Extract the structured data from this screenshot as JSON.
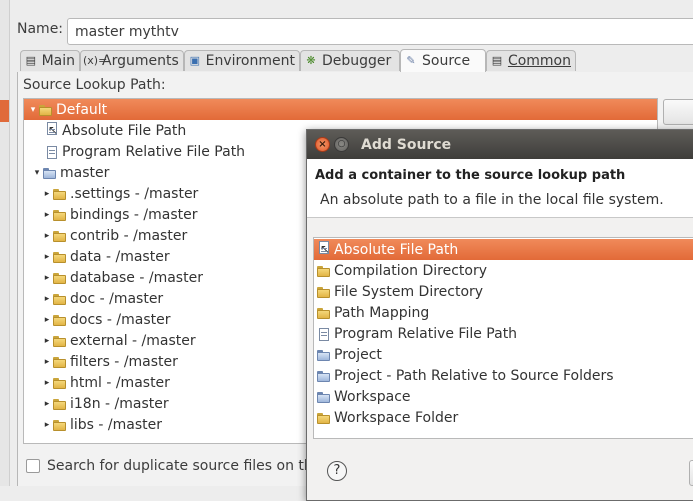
{
  "window": {
    "name_label": "Name:",
    "name_value": "master mythtv"
  },
  "tabs": [
    {
      "label": "Main",
      "icon": "main-tab-icon"
    },
    {
      "label": "Arguments",
      "icon": "arguments-icon"
    },
    {
      "label": "Environment",
      "icon": "environment-icon"
    },
    {
      "label": "Debugger",
      "icon": "debugger-bug-icon"
    },
    {
      "label": "Source",
      "icon": "source-icon",
      "active": true
    },
    {
      "label": "Common",
      "icon": "common-icon"
    }
  ],
  "source": {
    "lookup_label": "Source Lookup Path:",
    "tree": [
      {
        "label": "Default",
        "icon": "folder-icon",
        "expanded": true,
        "selected": true
      },
      {
        "label": "Absolute File Path",
        "icon": "absolute-path-icon"
      },
      {
        "label": "Program Relative File Path",
        "icon": "program-relative-icon"
      },
      {
        "label": "master",
        "icon": "project-folder-icon",
        "expanded": true
      },
      {
        "label": ".settings - /master",
        "icon": "folder-icon"
      },
      {
        "label": "bindings - /master",
        "icon": "folder-icon"
      },
      {
        "label": "contrib - /master",
        "icon": "folder-icon"
      },
      {
        "label": "data - /master",
        "icon": "folder-icon"
      },
      {
        "label": "database - /master",
        "icon": "folder-icon"
      },
      {
        "label": "doc - /master",
        "icon": "folder-icon"
      },
      {
        "label": "docs - /master",
        "icon": "folder-icon"
      },
      {
        "label": "external - /master",
        "icon": "folder-icon"
      },
      {
        "label": "filters - /master",
        "icon": "folder-icon"
      },
      {
        "label": "html - /master",
        "icon": "folder-icon"
      },
      {
        "label": "i18n - /master",
        "icon": "folder-icon"
      },
      {
        "label": "libs - /master",
        "icon": "folder-icon"
      }
    ],
    "duplicate_label": "Search for duplicate source files on the"
  },
  "dialog": {
    "title": "Add Source",
    "heading": "Add a container to the source lookup path",
    "description": "An absolute path to a file in the local file system.",
    "options": [
      {
        "label": "Absolute File Path",
        "selected": true
      },
      {
        "label": "Compilation Directory"
      },
      {
        "label": "File System Directory"
      },
      {
        "label": "Path Mapping"
      },
      {
        "label": "Program Relative File Path"
      },
      {
        "label": "Project"
      },
      {
        "label": "Project - Path Relative to Source Folders"
      },
      {
        "label": "Workspace"
      },
      {
        "label": "Workspace Folder"
      }
    ],
    "help_glyph": "?"
  },
  "colors": {
    "selection": "#e26a38",
    "dialog_titlebar": "#3e3d3a"
  }
}
